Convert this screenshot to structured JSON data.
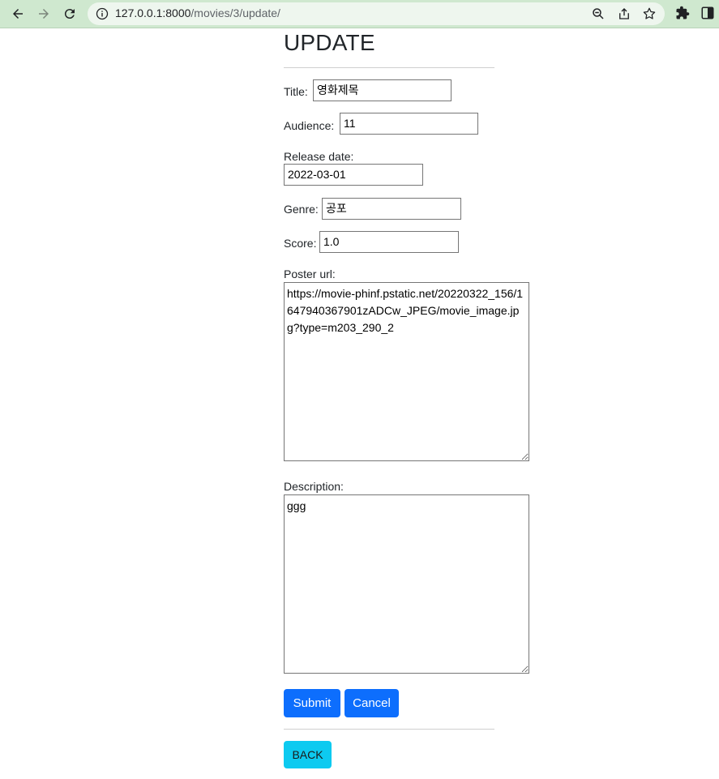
{
  "browser": {
    "url_host": "127.0.0.1:8000",
    "url_path": "/movies/3/update/"
  },
  "page": {
    "title": "UPDATE"
  },
  "form": {
    "title_label": "Title:",
    "title_value": "영화제목",
    "audience_label": "Audience:",
    "audience_value": "11",
    "release_label": "Release date:",
    "release_value": "2022-03-01",
    "genre_label": "Genre:",
    "genre_value": "공포",
    "score_label": "Score:",
    "score_value": "1.0",
    "poster_label": "Poster url:",
    "poster_value": "https://movie-phinf.pstatic.net/20220322_156/1647940367901zADCw_JPEG/movie_image.jpg?type=m203_290_2",
    "description_label": "Description:",
    "description_value": "ggg"
  },
  "buttons": {
    "submit": "Submit",
    "cancel": "Cancel",
    "back": "BACK"
  },
  "colors": {
    "chrome_bg": "#cfe8cf",
    "primary": "#0d6efd",
    "info": "#0dcaf0"
  }
}
